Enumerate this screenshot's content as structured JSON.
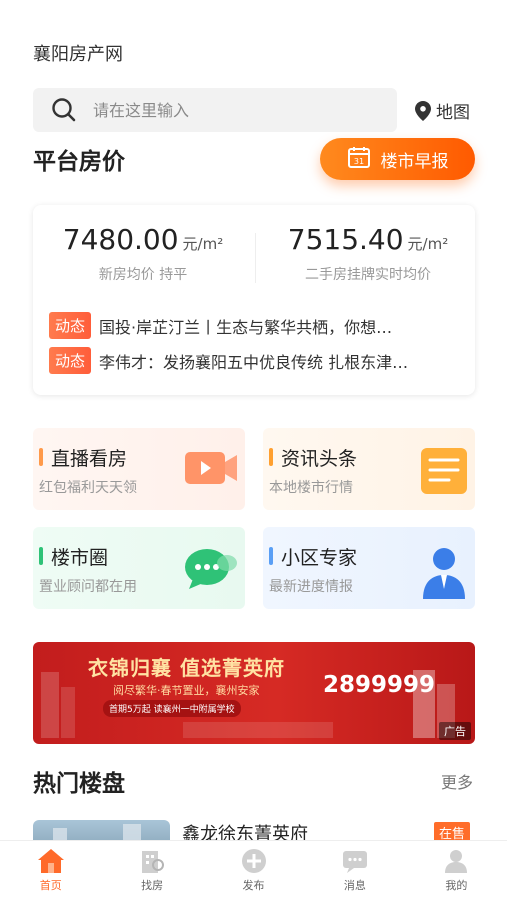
{
  "app_title": "襄阳房产网",
  "search": {
    "placeholder": "请在这里输入",
    "icon": "search-icon"
  },
  "map_link": {
    "label": "地图",
    "icon": "location-pin-icon"
  },
  "platform_section": {
    "title": "平台房价",
    "morning_report_button": {
      "label": "楼市早报",
      "icon": "calendar-icon",
      "calendar_day": "31"
    }
  },
  "prices": {
    "new_house": {
      "value": "7480.00",
      "unit": "元/m²",
      "label": "新房均价 持平"
    },
    "second_hand": {
      "value": "7515.40",
      "unit": "元/m²",
      "label": "二手房挂牌实时均价"
    }
  },
  "news": [
    {
      "tag": "动态",
      "text": "国投·岸芷汀兰丨生态与繁华共栖，你想…"
    },
    {
      "tag": "动态",
      "text": "李伟才：发扬襄阳五中优良传统 扎根东津…"
    }
  ],
  "tiles": [
    {
      "title": "直播看房",
      "subtitle": "红包福利天天领",
      "icon": "video-camera-icon",
      "accent": "#ff9a4a"
    },
    {
      "title": "资讯头条",
      "subtitle": "本地楼市行情",
      "icon": "document-list-icon",
      "accent": "#ffa030"
    },
    {
      "title": "楼市圈",
      "subtitle": "置业顾问都在用",
      "icon": "chat-bubble-icon",
      "accent": "#2fc277"
    },
    {
      "title": "小区专家",
      "subtitle": "最新进度情报",
      "icon": "expert-person-icon",
      "accent": "#5a9ff5"
    }
  ],
  "banner": {
    "headline": "衣锦归襄 值选菁英府",
    "subline": "阅尽繁华·春节置业，襄州安家",
    "promo": "首期5万起 读襄州一中附属学校",
    "phone": "2899999",
    "ad_tag": "广告"
  },
  "hot_section": {
    "title": "热门楼盘",
    "more_label": "更多"
  },
  "listing": {
    "name": "鑫龙徐东菁英府",
    "status": "在售"
  },
  "tabbar": [
    {
      "label": "首页",
      "icon": "home-icon",
      "active": true
    },
    {
      "label": "找房",
      "icon": "building-search-icon",
      "active": false
    },
    {
      "label": "发布",
      "icon": "plus-circle-icon",
      "active": false
    },
    {
      "label": "消息",
      "icon": "message-icon",
      "active": false
    },
    {
      "label": "我的",
      "icon": "user-icon",
      "active": false
    }
  ],
  "colors": {
    "accent_orange": "#ff6a2a",
    "tag_orange": "#ff6a3d",
    "banner_red": "#c21d1d"
  }
}
